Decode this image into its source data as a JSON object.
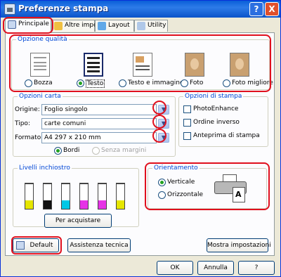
{
  "window": {
    "title": "Preferenze stampa",
    "help_label": "?",
    "close_label": "X"
  },
  "tabs": [
    {
      "label": "Principale"
    },
    {
      "label": "Altre impost."
    },
    {
      "label": "Layout"
    },
    {
      "label": "Utility"
    }
  ],
  "quality": {
    "group_label": "Opzione qualità",
    "options": [
      {
        "label": "Bozza",
        "selected": false
      },
      {
        "label": "Testo",
        "selected": true
      },
      {
        "label": "Testo e immagine",
        "selected": false
      },
      {
        "label": "Foto",
        "selected": false
      },
      {
        "label": "Foto migliore",
        "selected": false
      }
    ]
  },
  "paper": {
    "group_label": "Opzioni carta",
    "origin_label": "Origine:",
    "origin_value": "Foglio singolo",
    "type_label": "Tipo:",
    "type_value": "carte comuni",
    "format_label": "Formato:",
    "format_value": "A4 297 x 210 mm",
    "bordered_label": "Bordi",
    "borderless_label": "Senza margini"
  },
  "print_options": {
    "group_label": "Opzioni di stampa",
    "items": [
      {
        "label": "PhotoEnhance",
        "checked": false
      },
      {
        "label": "Ordine inverso",
        "checked": false
      },
      {
        "label": "Anteprima di stampa",
        "checked": false
      }
    ]
  },
  "ink": {
    "group_label": "Livelli inchiostro",
    "colors": [
      "#e6e600",
      "#111111",
      "#00c8e6",
      "#e632e6",
      "#e632e6",
      "#e6e600"
    ],
    "buy_button": "Per acquistare"
  },
  "orientation": {
    "group_label": "Orientamento",
    "portrait_label": "Verticale",
    "landscape_label": "Orizzontale",
    "selected": "portrait"
  },
  "buttons": {
    "default": "Default",
    "support": "Assistenza tecnica",
    "show_settings": "Mostra impostazioni",
    "ok": "OK",
    "cancel": "Annulla",
    "help": "?"
  }
}
